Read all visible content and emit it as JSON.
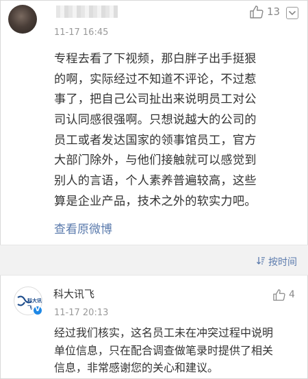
{
  "comment1": {
    "time": "11-17 16:45",
    "likes": "13",
    "body_lines": [
      "专程去看了下视频，那白胖子出手挺狠",
      "的啊，实际经过不知道不评论，不过惹",
      "事了，把自己公司扯出来说明员工对公",
      "司认同感很强啊。只想说越大的公司的",
      "员工或者发达国家的领事馆员工，官方",
      "大部门除外，与他们接触就可以感觉到",
      "别人的言语，个人素养普遍较高，这些",
      "算是企业产品，技术之外的软实力吧。"
    ],
    "link": "查看原微博"
  },
  "sortbar": {
    "label": "按时间",
    "icon": "sort-icon"
  },
  "comment2": {
    "username": "科大讯飞",
    "time": "11-17 20:13",
    "likes": "4",
    "avatar_text": "科大讯飞",
    "body_lines": [
      "经过我们核实，这名员工未在冲突过程中说明",
      "单位信息，只在配合调查做笔录时提供了相关",
      "信息，非常感谢您的关心和建议。"
    ]
  },
  "colors": {
    "link": "#5b7bad",
    "muted": "#999999",
    "sortbar_bg": "#f2f2f2"
  }
}
